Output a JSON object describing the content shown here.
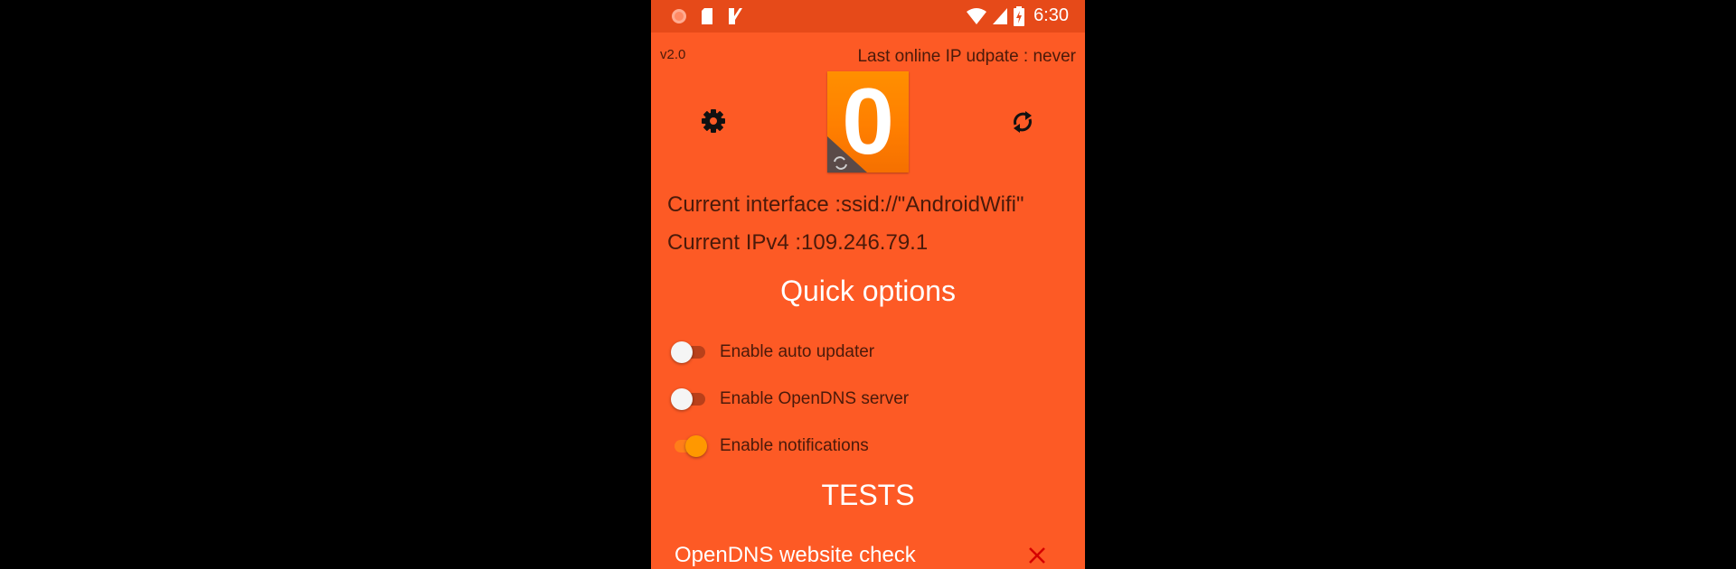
{
  "status_bar": {
    "time": "6:30",
    "left_icons": [
      "record-icon",
      "sd-card-icon",
      "check-app-icon"
    ],
    "right_icons": [
      "wifi-icon",
      "signal-icon",
      "battery-icon"
    ]
  },
  "header": {
    "version": "v2.0",
    "last_update": "Last online IP udpate : never"
  },
  "logo": {
    "digit": "0"
  },
  "info": {
    "interface": "Current interface :ssid://\"AndroidWifi\"",
    "ipv4": "Current IPv4 :109.246.79.1"
  },
  "quick_options": {
    "title": "Quick options",
    "items": [
      {
        "label": "Enable auto updater",
        "enabled": false
      },
      {
        "label": "Enable OpenDNS server",
        "enabled": false
      },
      {
        "label": "Enable notifications",
        "enabled": true
      }
    ]
  },
  "tests": {
    "title": "TESTS",
    "items": [
      {
        "label": "OpenDNS website check",
        "status": "failed"
      }
    ]
  },
  "colors": {
    "background": "#fd5a25",
    "status_bar": "#e64a19",
    "accent": "#ff9800",
    "fail": "#d50000"
  }
}
